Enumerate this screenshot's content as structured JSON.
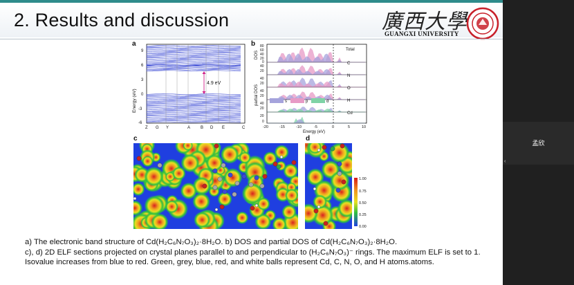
{
  "slide": {
    "title": "2.  Results and discussion",
    "university_calligraphy": "廣西大學",
    "university_name": "GUANGXI UNIVERSITY"
  },
  "panels": {
    "a": {
      "letter": "a",
      "y_axis_label": "Energy (eV)",
      "y_ticks": [
        "9",
        "6",
        "3",
        "0",
        "-3",
        "-6"
      ],
      "x_ticks": [
        "Z",
        "G",
        "Y",
        "",
        "A",
        "B",
        "D",
        "E",
        "",
        "C"
      ],
      "gap_label": "4.9 eV"
    },
    "b": {
      "letter": "b",
      "y_label_top": "DOS",
      "y_label_partial": "partial DOS",
      "x_label": "Energy (eV)",
      "x_ticks": [
        "-20",
        "-15",
        "-10",
        "-5",
        "0",
        "5",
        "10"
      ],
      "total_ticks": [
        "80",
        "60",
        "40",
        "20",
        "0"
      ],
      "rows": [
        {
          "label": "Total"
        },
        {
          "label": "C",
          "ticks": [
            "40",
            "20"
          ]
        },
        {
          "label": "N",
          "ticks": [
            "40",
            "20"
          ]
        },
        {
          "label": "O",
          "ticks": [
            "40",
            "20"
          ]
        },
        {
          "label": "H",
          "ticks": [
            "40",
            "20"
          ]
        },
        {
          "label": "Cd",
          "ticks": [
            "20",
            "0"
          ]
        }
      ],
      "legend": [
        "s",
        "p",
        "d"
      ]
    },
    "c": {
      "letter": "c"
    },
    "d": {
      "letter": "d"
    },
    "colorbar": {
      "ticks": [
        "1.00",
        "0.75",
        "0.50",
        "0.25",
        "0.00"
      ]
    }
  },
  "caption": {
    "line1": "a) The electronic band structure of  Cd(H₂C₆N₇O₃)₂·8H₂O. b) DOS and partial DOS of  Cd(H₂C₆N₇O₃)₂·8H₂O.",
    "line2": "c), d) 2D ELF sections projected on crystal planes parallel to and perpendicular to (H₂C₆N₇O₃)⁻ rings. The maximum ELF is set to 1. Isovalue increases from blue to red. Green, grey, blue, red, and white balls represent Cd, C, N, O, and H atoms.atoms."
  },
  "meeting": {
    "participant_name": "孟欣",
    "collapse_glyph": "‹"
  },
  "colors": {
    "band_lines": "#4a58d8",
    "gap_arrow": "#d0208a",
    "dos_pink": "#e79ac6",
    "dos_purple": "#a5a3dc",
    "dos_green": "#7fd3a6",
    "elf_blue": "#1f3fe0",
    "teal_accent": "#2e8b8b"
  }
}
